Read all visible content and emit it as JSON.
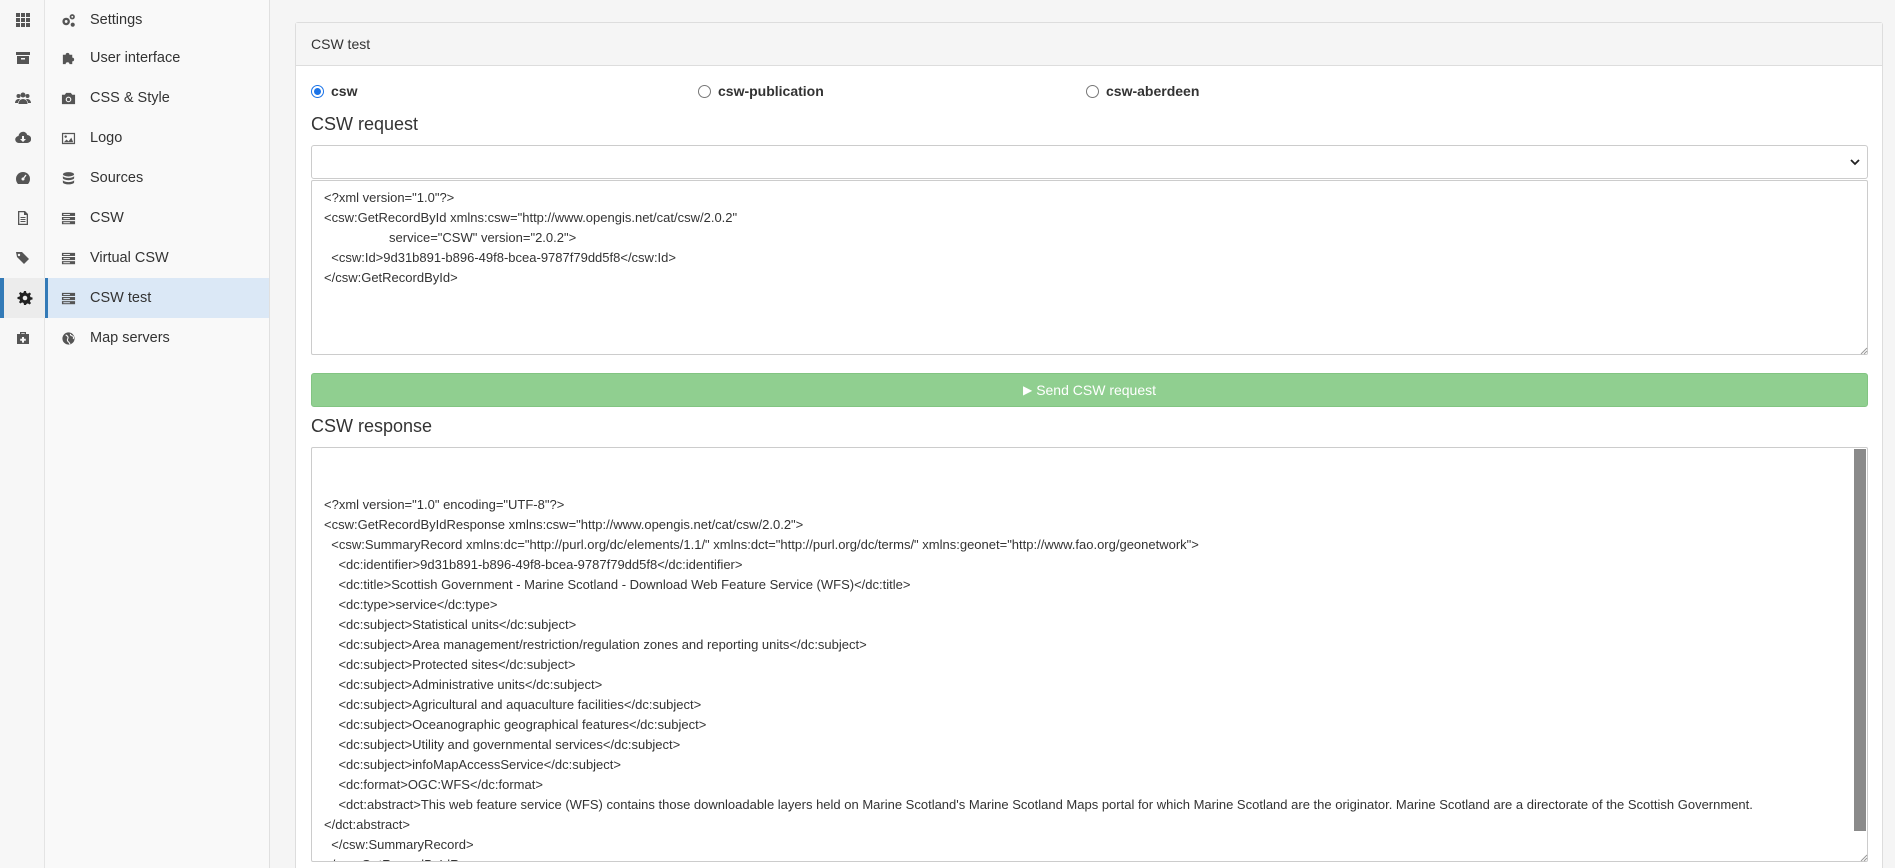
{
  "rail": {
    "items": [
      {
        "icon": "grid-icon"
      },
      {
        "icon": "archive-icon"
      },
      {
        "icon": "users-icon"
      },
      {
        "icon": "cloud-download-icon"
      },
      {
        "icon": "dashboard-icon"
      },
      {
        "icon": "file-text-icon"
      },
      {
        "icon": "tags-icon"
      },
      {
        "icon": "gear-icon",
        "active": true
      },
      {
        "icon": "medkit-icon"
      }
    ]
  },
  "menu": {
    "items": [
      {
        "label": "Settings",
        "icon": "cogs-icon"
      },
      {
        "label": "User interface",
        "icon": "puzzle-icon"
      },
      {
        "label": "CSS & Style",
        "icon": "camera-icon"
      },
      {
        "label": "Logo",
        "icon": "image-icon"
      },
      {
        "label": "Sources",
        "icon": "database-icon"
      },
      {
        "label": "CSW",
        "icon": "server-icon"
      },
      {
        "label": "Virtual CSW",
        "icon": "server-icon"
      },
      {
        "label": "CSW test",
        "icon": "server-icon",
        "active": true
      },
      {
        "label": "Map servers",
        "icon": "globe-icon"
      }
    ]
  },
  "panel": {
    "title": "CSW test",
    "radios": [
      {
        "label": "csw",
        "checked": true
      },
      {
        "label": "csw-publication",
        "checked": false
      },
      {
        "label": "csw-aberdeen",
        "checked": false
      }
    ],
    "request_label": "CSW request",
    "request_select_value": "",
    "request_body": "<?xml version=\"1.0\"?>\n<csw:GetRecordById xmlns:csw=\"http://www.opengis.net/cat/csw/2.0.2\"\n                  service=\"CSW\" version=\"2.0.2\">\n  <csw:Id>9d31b891-b896-49f8-bcea-9787f79dd5f8</csw:Id>\n</csw:GetRecordById>",
    "send_button": "Send CSW request",
    "response_label": "CSW response",
    "response_body": "<?xml version=\"1.0\" encoding=\"UTF-8\"?>\n<csw:GetRecordByIdResponse xmlns:csw=\"http://www.opengis.net/cat/csw/2.0.2\">\n  <csw:SummaryRecord xmlns:dc=\"http://purl.org/dc/elements/1.1/\" xmlns:dct=\"http://purl.org/dc/terms/\" xmlns:geonet=\"http://www.fao.org/geonetwork\">\n    <dc:identifier>9d31b891-b896-49f8-bcea-9787f79dd5f8</dc:identifier>\n    <dc:title>Scottish Government - Marine Scotland - Download Web Feature Service (WFS)</dc:title>\n    <dc:type>service</dc:type>\n    <dc:subject>Statistical units</dc:subject>\n    <dc:subject>Area management/restriction/regulation zones and reporting units</dc:subject>\n    <dc:subject>Protected sites</dc:subject>\n    <dc:subject>Administrative units</dc:subject>\n    <dc:subject>Agricultural and aquaculture facilities</dc:subject>\n    <dc:subject>Oceanographic geographical features</dc:subject>\n    <dc:subject>Utility and governmental services</dc:subject>\n    <dc:subject>infoMapAccessService</dc:subject>\n    <dc:format>OGC:WFS</dc:format>\n    <dct:abstract>This web feature service (WFS) contains those downloadable layers held on Marine Scotland's Marine Scotland Maps portal for which Marine Scotland are the originator. Marine Scotland are a directorate of the Scottish Government.</dct:abstract>\n  </csw:SummaryRecord>\n</csw:GetRecordByIdResponse>"
  },
  "colors": {
    "accent": "#337ab7",
    "active_bg": "#dbe8f6",
    "send_button_bg": "#90cf90",
    "radio_checked": "#1a73e8"
  }
}
